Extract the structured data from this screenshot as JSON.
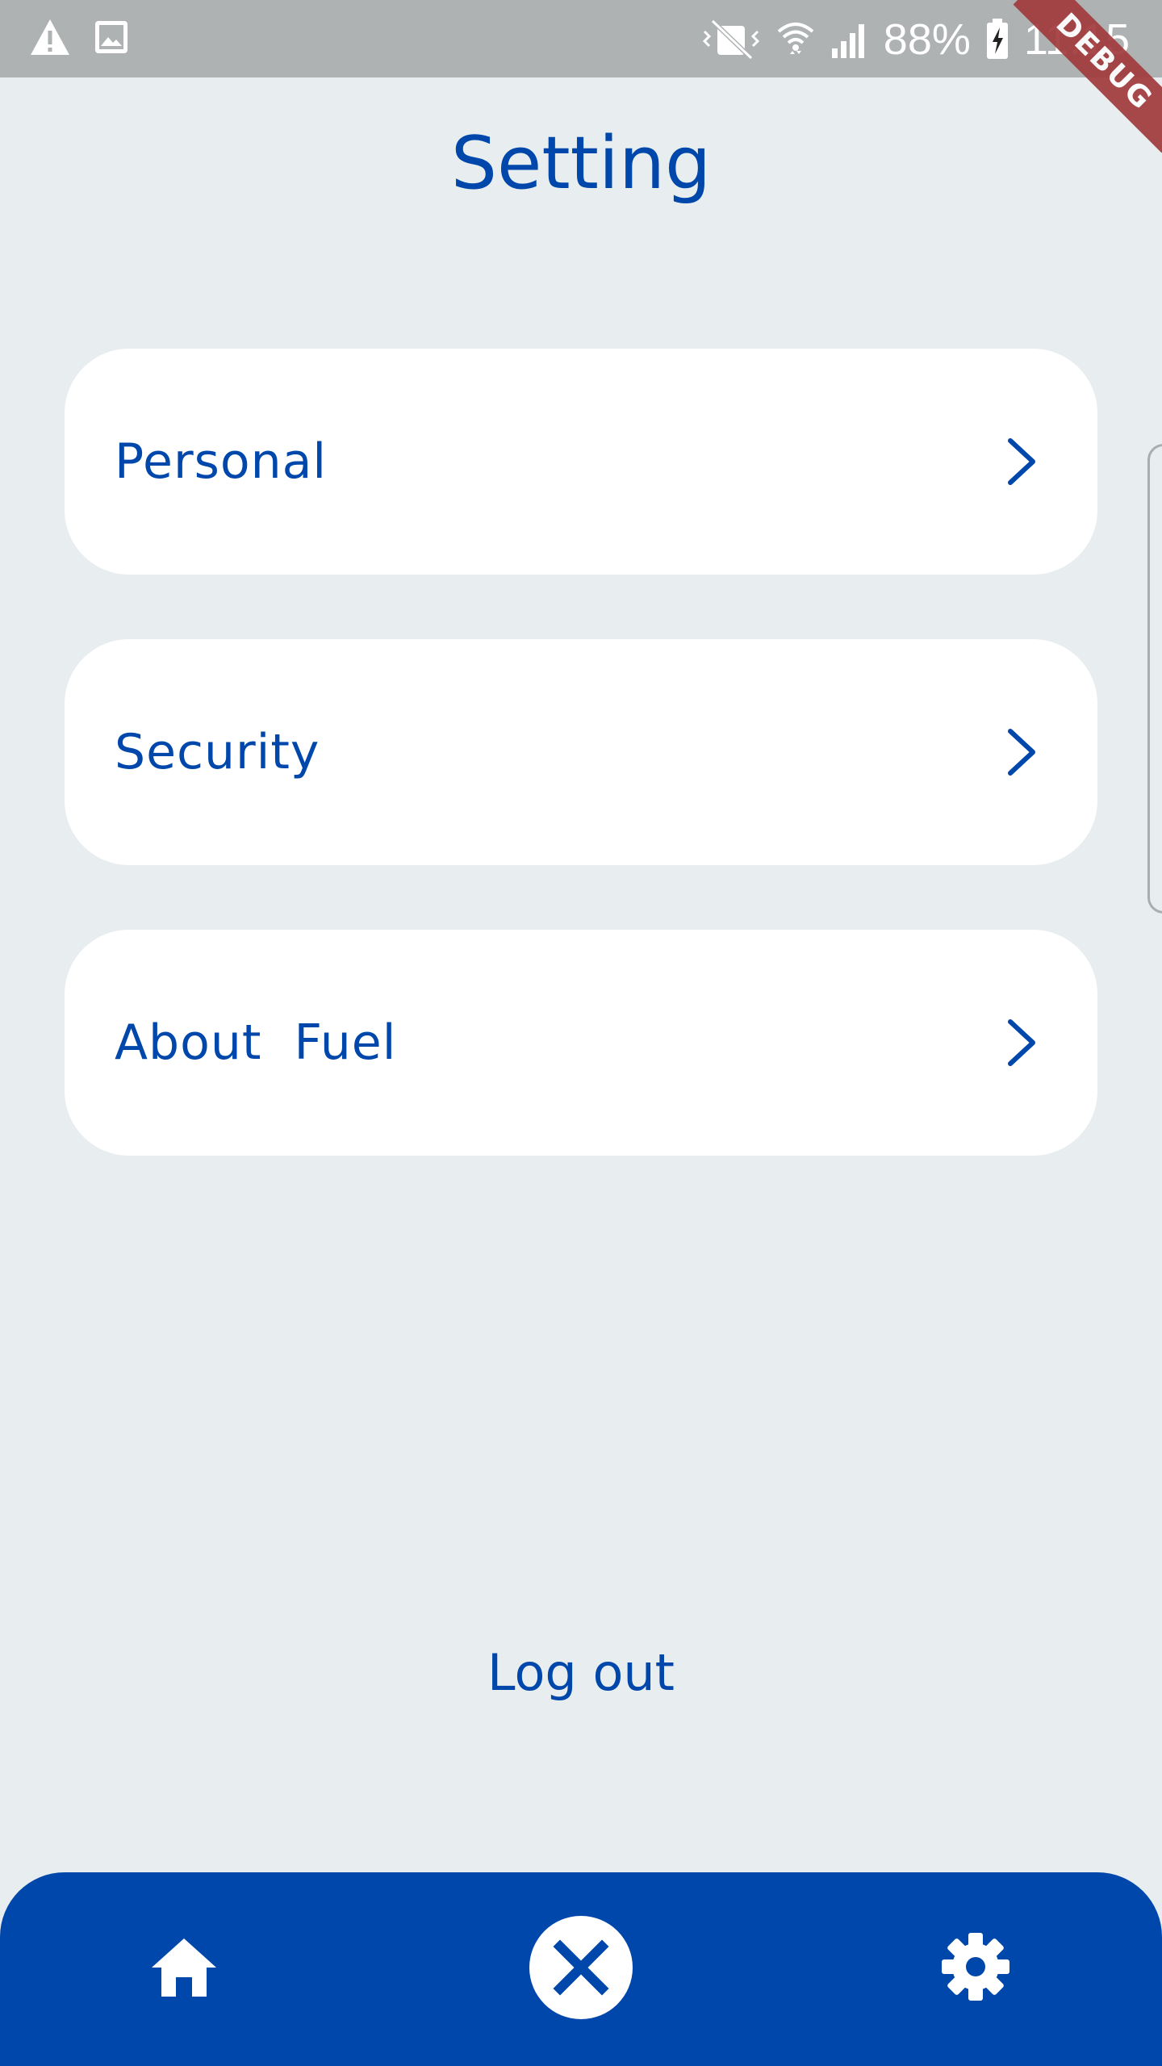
{
  "status_bar": {
    "battery": "88%",
    "time": "11:15",
    "icons": [
      "warning-icon",
      "image-icon",
      "vibrate-icon",
      "wifi-icon",
      "signal-icon",
      "battery-charging-icon"
    ]
  },
  "debug_banner": "DEBUG",
  "header": {
    "title": "Setting"
  },
  "settings": {
    "items": [
      {
        "label": "Personal"
      },
      {
        "label": "Security"
      },
      {
        "label": "About  Fuel"
      }
    ]
  },
  "logout_label": "Log out",
  "bottom_nav": {
    "items": [
      "home-icon",
      "close-icon",
      "gear-icon"
    ]
  },
  "colors": {
    "primary": "#0047ab",
    "background": "#e8eeef",
    "card": "#ffffff",
    "status_bar": "#aeb2b2"
  }
}
